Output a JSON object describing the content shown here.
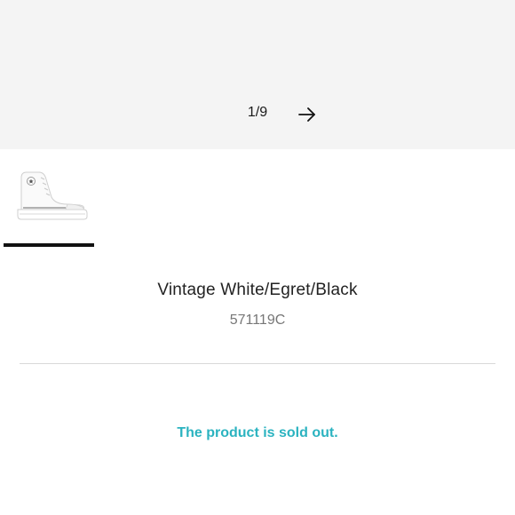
{
  "gallery": {
    "counter": "1/9",
    "next_icon": "arrow-right-icon",
    "thumbnail_icon": "high-top-sneaker-image",
    "background_color": "#f4f4f4"
  },
  "product": {
    "color_name": "Vintage White/Egret/Black",
    "sku": "571119C"
  },
  "status": {
    "message": "The product is sold out.",
    "color": "#2bb3c0"
  }
}
